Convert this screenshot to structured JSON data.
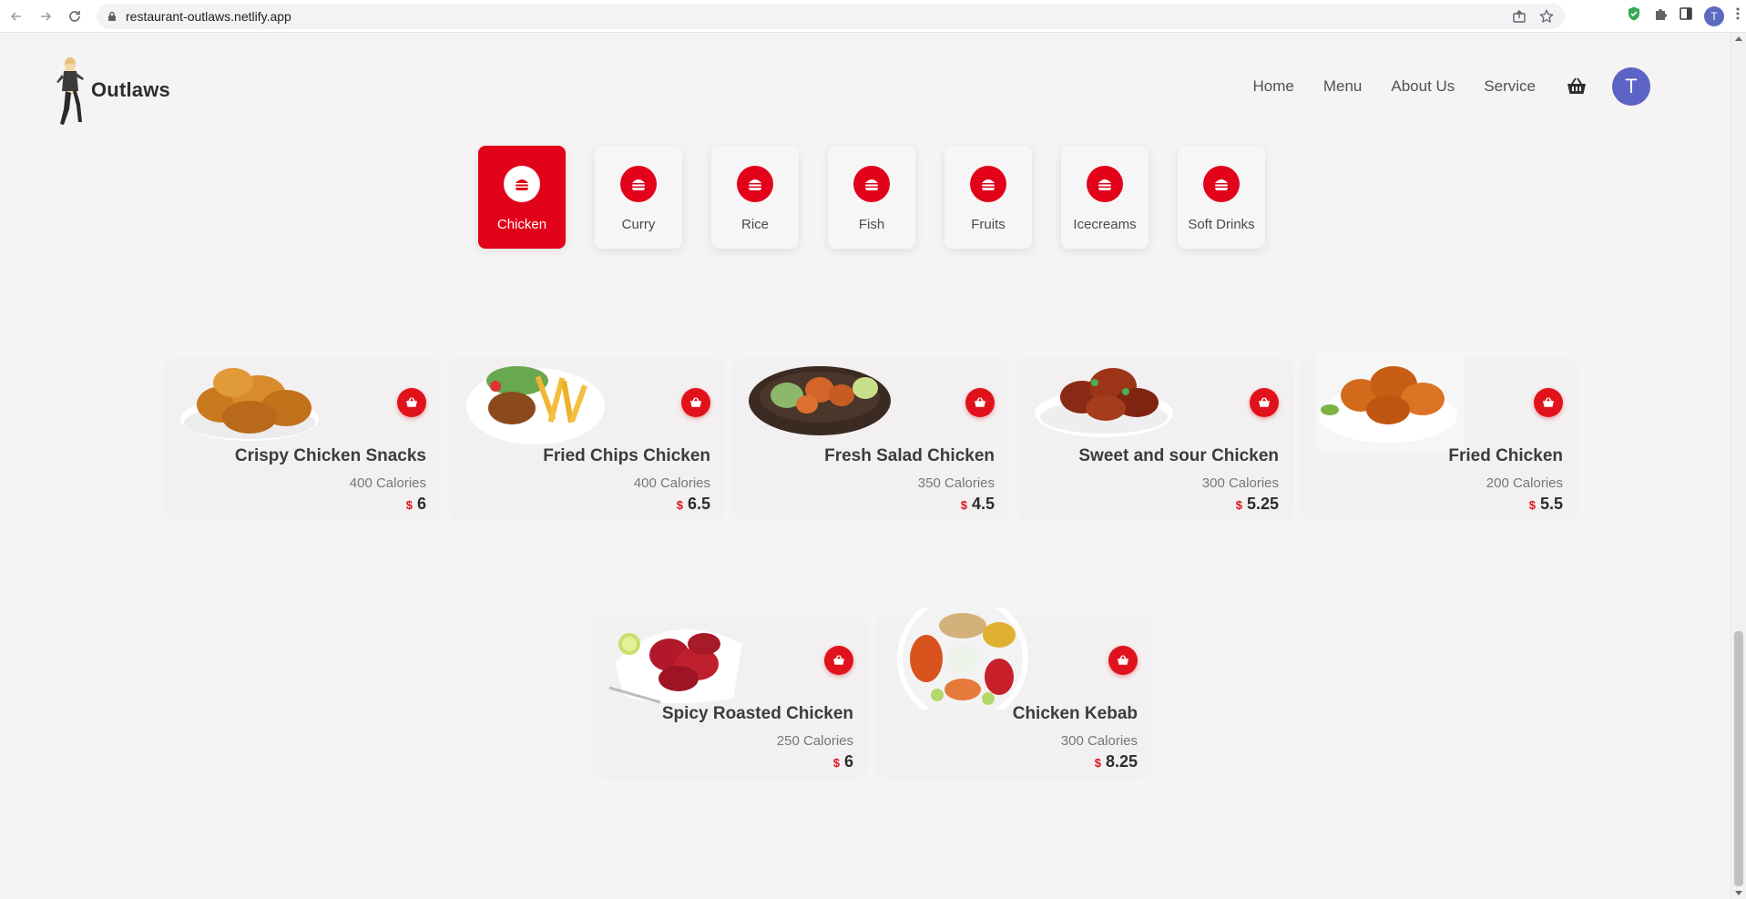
{
  "browser": {
    "url": "restaurant-outlaws.netlify.app",
    "profile_initial": "T"
  },
  "header": {
    "brand": "Outlaws",
    "nav": [
      "Home",
      "Menu",
      "About Us",
      "Service"
    ],
    "avatar_initial": "T"
  },
  "categories": [
    {
      "label": "Chicken",
      "active": true
    },
    {
      "label": "Curry",
      "active": false
    },
    {
      "label": "Rice",
      "active": false
    },
    {
      "label": "Fish",
      "active": false
    },
    {
      "label": "Fruits",
      "active": false
    },
    {
      "label": "Icecreams",
      "active": false
    },
    {
      "label": "Soft Drinks",
      "active": false
    }
  ],
  "products": [
    {
      "name": "Crispy Chicken Snacks",
      "calories": "400 Calories",
      "currency": "$",
      "price": "6"
    },
    {
      "name": "Fried Chips Chicken",
      "calories": "400 Calories",
      "currency": "$",
      "price": "6.5"
    },
    {
      "name": "Fresh Salad Chicken",
      "calories": "350 Calories",
      "currency": "$",
      "price": "4.5"
    },
    {
      "name": "Sweet and sour Chicken",
      "calories": "300 Calories",
      "currency": "$",
      "price": "5.25"
    },
    {
      "name": "Fried Chicken",
      "calories": "200 Calories",
      "currency": "$",
      "price": "5.5"
    },
    {
      "name": "Spicy Roasted Chicken",
      "calories": "250 Calories",
      "currency": "$",
      "price": "6"
    },
    {
      "name": "Chicken Kebab",
      "calories": "300 Calories",
      "currency": "$",
      "price": "8.25"
    }
  ],
  "colors": {
    "accent": "#e2021a",
    "background": "#f5f3f3",
    "avatar": "#5b63c4"
  },
  "icons": {
    "category": "burger-icon",
    "add_to_cart": "basket-icon"
  }
}
